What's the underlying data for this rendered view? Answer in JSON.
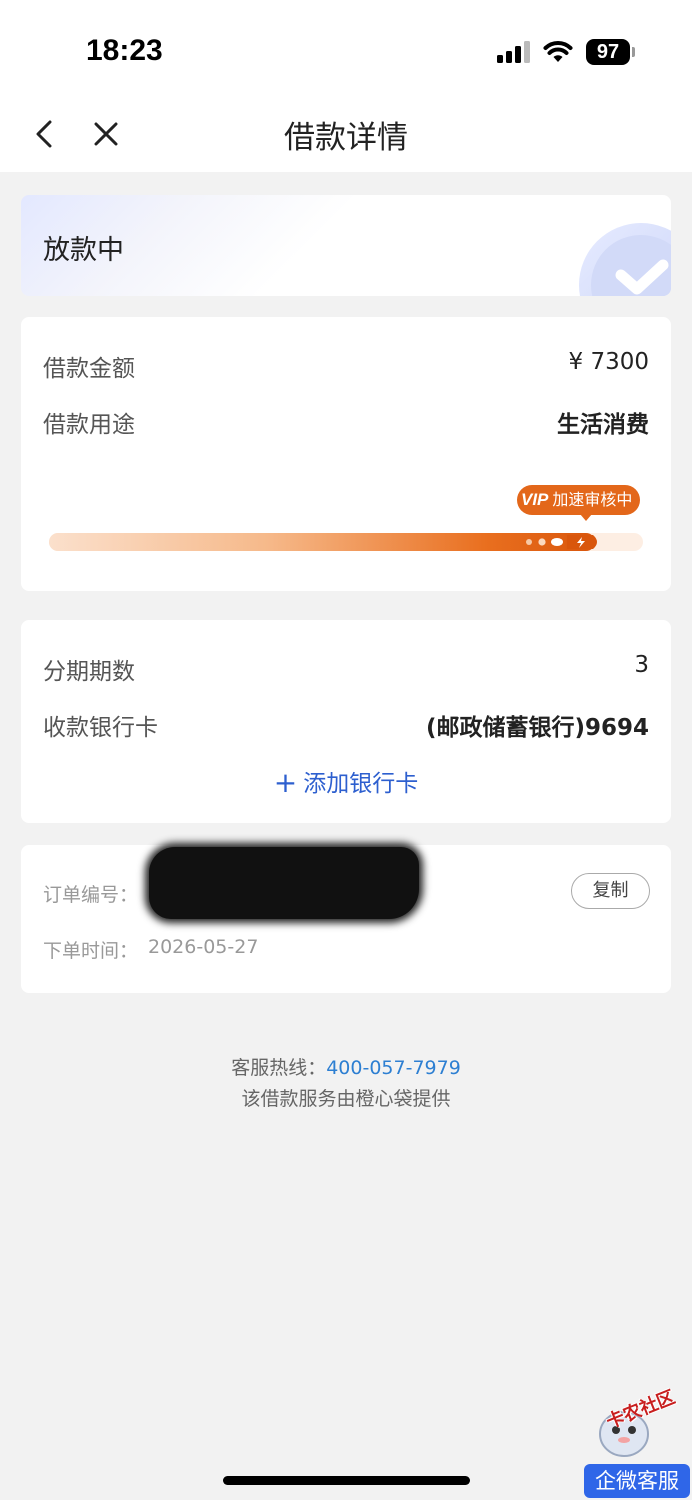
{
  "status_bar": {
    "time": "18:23",
    "battery": "97"
  },
  "nav": {
    "title": "借款详情"
  },
  "status": {
    "text": "放款中"
  },
  "loan": {
    "amount_label": "借款金额",
    "amount_value": "¥ 7300",
    "purpose_label": "借款用途",
    "purpose_value": "生活消费",
    "badge_vip": "VIP",
    "badge_text": "加速审核中",
    "progress": 0.92
  },
  "installment": {
    "periods_label": "分期期数",
    "periods_value": "3",
    "bank_label": "收款银行卡",
    "bank_value": "(邮政储蓄银行)9694",
    "add_card": "添加银行卡"
  },
  "order": {
    "number_label": "订单编号：",
    "time_label": "下单时间：",
    "time_value": "2026-05-27",
    "copy_label": "复制"
  },
  "footer": {
    "hotline_label": "客服热线：",
    "hotline_number": "400-057-7979",
    "provider": "该借款服务由橙心袋提供"
  },
  "overlay": {
    "watermark": "卡农社区",
    "service_button": "企微客服"
  },
  "colors": {
    "accent": "#e3671a",
    "link": "#2d5fcf",
    "background": "#f2f2f2"
  }
}
